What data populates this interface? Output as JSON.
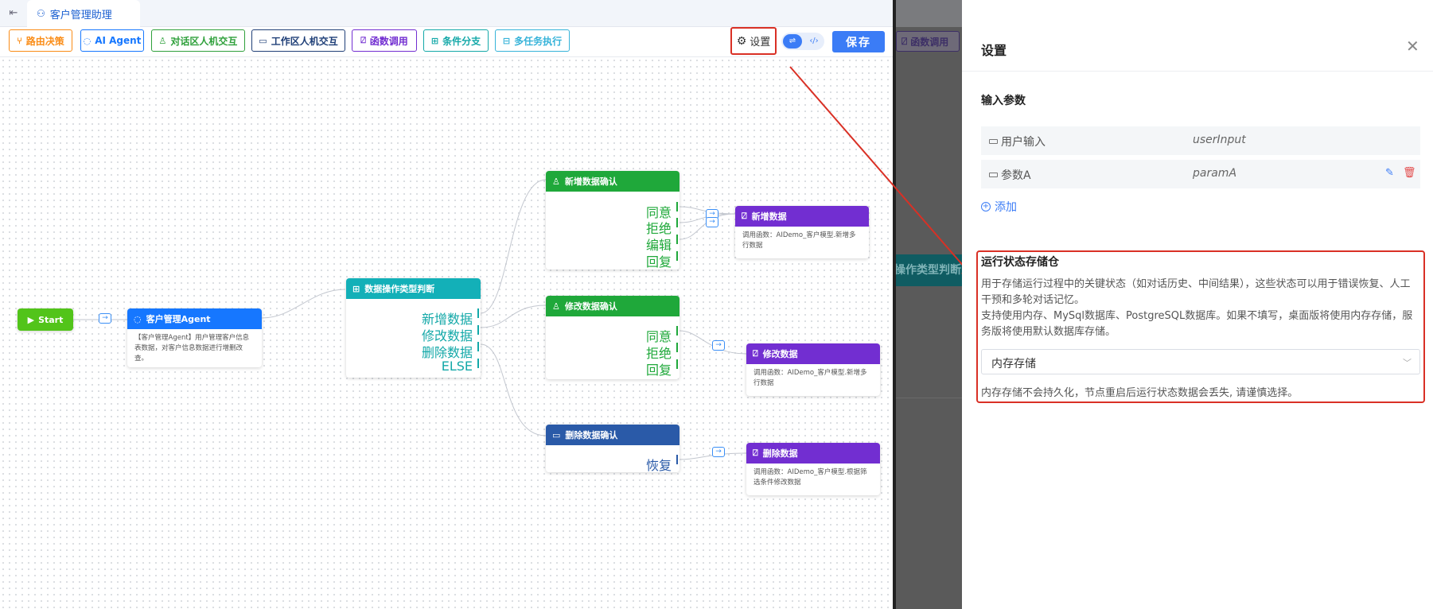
{
  "app": {
    "tab_label": "客户管理助理"
  },
  "toolbar": {
    "buttons": [
      {
        "label": "路由决策",
        "color": "#fa8c16"
      },
      {
        "label": "AI Agent",
        "color": "#1677ff"
      },
      {
        "label": "对话区人机交互",
        "color": "#2fa03b"
      },
      {
        "label": "工作区人机交互",
        "color": "#1f3f77"
      },
      {
        "label": "函数调用",
        "color": "#722ed1"
      },
      {
        "label": "条件分支",
        "color": "#13a8a8"
      },
      {
        "label": "多任务执行",
        "color": "#36b3d9"
      }
    ],
    "settings_label": "设置",
    "save_label": "保存"
  },
  "canvas": {
    "start": {
      "label": "Start"
    },
    "agent": {
      "title": "客户管理Agent",
      "desc": "【客户管理Agent】用户管理客户信息表数据，对客户信息数据进行增删改查。"
    },
    "router": {
      "title": "数据操作类型判断",
      "outs": [
        "新增数据",
        "修改数据",
        "删除数据",
        "ELSE"
      ]
    },
    "confirm_add": {
      "title": "新增数据确认",
      "outs": [
        "同意",
        "拒绝",
        "编辑",
        "回复"
      ]
    },
    "confirm_edit": {
      "title": "修改数据确认",
      "outs": [
        "同意",
        "拒绝",
        "回复"
      ]
    },
    "confirm_delete": {
      "title": "删除数据确认",
      "outs": [
        "恢复"
      ]
    },
    "fn_add": {
      "title": "新增数据",
      "desc": "调用函数：AIDemo_客户模型.新增多行数据"
    },
    "fn_edit": {
      "title": "修改数据",
      "desc": "调用函数：AIDemo_客户模型.新增多行数据"
    },
    "fn_delete": {
      "title": "删除数据",
      "desc": "调用函数：AIDemo_客户模型.根据筛选条件修改数据"
    }
  },
  "overlay": {
    "chip_label": "函数调用",
    "teal_label": "操作类型判断"
  },
  "drawer": {
    "title": "设置",
    "input_section": "输入参数",
    "params": [
      {
        "name": "用户输入",
        "value": "userInput"
      },
      {
        "name": "参数A",
        "value": "paramA"
      }
    ],
    "add_label": "添加",
    "store": {
      "title": "运行状态存储仓",
      "desc1": "用于存储运行过程中的关键状态（如对话历史、中间结果），这些状态可以用于错误恢复、人工干预和多轮对话记忆。",
      "desc2": "支持使用内存、MySql数据库、PostgreSQL数据库。如果不填写，桌面版将使用内存存储，服务版将使用默认数据库存储。",
      "selected": "内存存储",
      "note": "内存存储不会持久化，节点重启后运行状态数据会丢失, 请谨慎选择。"
    }
  }
}
